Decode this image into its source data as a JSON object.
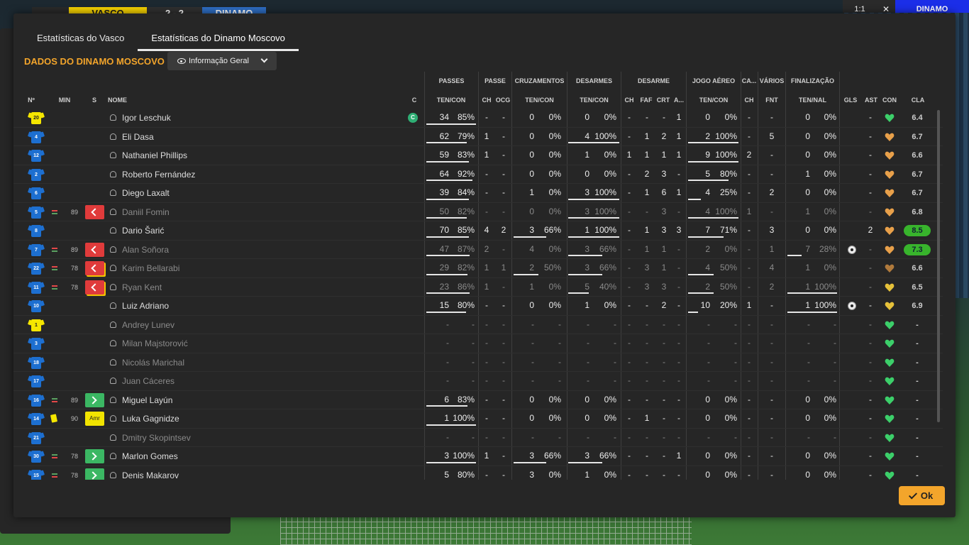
{
  "scoreboard": {
    "home": "VASCO",
    "score": "2 - 2",
    "away": "DINAMO",
    "right_btn1": "1:1",
    "right_btn2": "✕",
    "right_btn3": "DINAMO"
  },
  "tabs": [
    {
      "label": "Estatísticas do Vasco",
      "active": false
    },
    {
      "label": "Estatísticas do Dinamo Moscovo",
      "active": true
    }
  ],
  "section_title": "DADOS DO DINAMO MOSCOVO",
  "view_selector": {
    "label": "Informação Geral"
  },
  "group_headers": [
    "PASSES",
    "PASSE",
    "CRUZAMENTOS",
    "DESARMES",
    "DESARME",
    "JOGO AÉREO",
    "CA...",
    "VÁRIOS",
    "FINALIZAÇÃO"
  ],
  "column_headers": {
    "num": "Nº",
    "min": "MIN",
    "s": "S",
    "name": "NOME",
    "c": "C",
    "passes": "TEN/CON",
    "passe_ch": "CH",
    "passe_ocg": "OCG",
    "cruz": "TEN/CON",
    "des": "TEN/CON",
    "d_ch": "CH",
    "d_faf": "FAF",
    "d_crt": "CRT",
    "d_a": "A...",
    "aereo": "TEN/CON",
    "ca_ch": "CH",
    "fnt": "FNT",
    "fin": "TEN/NAL",
    "gls": "GLS",
    "ast": "AST",
    "con": "CON",
    "cla": "CLA"
  },
  "players": [
    {
      "num": "20",
      "kit": "yellow",
      "name": "Igor Leschuk",
      "captain": "C",
      "min": "",
      "sub": "",
      "pt": "34",
      "pp": "85%",
      "ch": "-",
      "ocg": "-",
      "ct": "0",
      "cp": "0%",
      "dt": "0",
      "dp": "0%",
      "dch": "-",
      "faf": "-",
      "crt": "-",
      "da": "1",
      "at": "0",
      "ap": "0%",
      "cach": "-",
      "fnt": "-",
      "ft": "0",
      "fp": "0%",
      "gls": "",
      "ast": "-",
      "con": "green",
      "cla": "6.4",
      "dim": false,
      "u": [
        1,
        0,
        0,
        0,
        0,
        0
      ],
      "clag": false
    },
    {
      "num": "4",
      "kit": "blue",
      "name": "Eli Dasa",
      "captain": "",
      "min": "",
      "sub": "",
      "pt": "62",
      "pp": "79%",
      "ch": "1",
      "ocg": "-",
      "ct": "0",
      "cp": "0%",
      "dt": "4",
      "dp": "100%",
      "dch": "-",
      "faf": "1",
      "crt": "2",
      "da": "1",
      "at": "2",
      "ap": "100%",
      "cach": "-",
      "fnt": "5",
      "ft": "0",
      "fp": "0%",
      "gls": "",
      "ast": "-",
      "con": "orange",
      "cla": "6.7",
      "dim": false,
      "u": [
        0.82,
        0,
        0,
        1,
        1,
        0
      ],
      "clag": false
    },
    {
      "num": "12",
      "kit": "blue",
      "name": "Nathaniel Phillips",
      "captain": "",
      "min": "",
      "sub": "",
      "pt": "59",
      "pp": "83%",
      "ch": "1",
      "ocg": "-",
      "ct": "0",
      "cp": "0%",
      "dt": "1",
      "dp": "0%",
      "dch": "1",
      "faf": "1",
      "crt": "1",
      "da": "1",
      "at": "9",
      "ap": "100%",
      "cach": "2",
      "fnt": "-",
      "ft": "0",
      "fp": "0%",
      "gls": "",
      "ast": "-",
      "con": "orange",
      "cla": "6.6",
      "dim": false,
      "u": [
        0.86,
        0,
        0,
        0,
        1,
        0
      ],
      "clag": false
    },
    {
      "num": "2",
      "kit": "blue",
      "name": "Roberto Fernández",
      "captain": "",
      "min": "",
      "sub": "",
      "pt": "64",
      "pp": "92%",
      "ch": "-",
      "ocg": "-",
      "ct": "0",
      "cp": "0%",
      "dt": "0",
      "dp": "0%",
      "dch": "-",
      "faf": "2",
      "crt": "3",
      "da": "-",
      "at": "5",
      "ap": "80%",
      "cach": "-",
      "fnt": "-",
      "ft": "1",
      "fp": "0%",
      "gls": "",
      "ast": "-",
      "con": "orange",
      "cla": "6.7",
      "dim": false,
      "u": [
        0.93,
        0,
        0,
        0,
        0.8,
        0
      ],
      "clag": false
    },
    {
      "num": "6",
      "kit": "blue",
      "name": "Diego Laxalt",
      "captain": "",
      "min": "",
      "sub": "",
      "pt": "39",
      "pp": "84%",
      "ch": "-",
      "ocg": "-",
      "ct": "1",
      "cp": "0%",
      "dt": "3",
      "dp": "100%",
      "dch": "-",
      "faf": "1",
      "crt": "6",
      "da": "1",
      "at": "4",
      "ap": "25%",
      "cach": "-",
      "fnt": "2",
      "ft": "0",
      "fp": "0%",
      "gls": "",
      "ast": "-",
      "con": "orange",
      "cla": "6.7",
      "dim": false,
      "u": [
        0.85,
        0,
        0,
        1,
        0.25,
        0
      ],
      "clag": false
    },
    {
      "num": "5",
      "kit": "blue",
      "name": "Daniil Fomin",
      "captain": "",
      "min": "89",
      "sub": "out",
      "pt": "50",
      "pp": "82%",
      "ch": "-",
      "ocg": "-",
      "ct": "0",
      "cp": "0%",
      "dt": "3",
      "dp": "100%",
      "dch": "-",
      "faf": "-",
      "crt": "3",
      "da": "-",
      "at": "4",
      "ap": "100%",
      "cach": "1",
      "fnt": "-",
      "ft": "1",
      "fp": "0%",
      "gls": "",
      "ast": "-",
      "con": "orange",
      "cla": "6.8",
      "dim": true,
      "u": [
        0.82,
        0,
        0,
        1,
        1,
        0
      ],
      "clag": false
    },
    {
      "num": "8",
      "kit": "blue",
      "name": "Dario Šarić",
      "captain": "",
      "min": "",
      "sub": "",
      "pt": "70",
      "pp": "85%",
      "ch": "4",
      "ocg": "2",
      "ct": "3",
      "cp": "66%",
      "dt": "1",
      "dp": "100%",
      "dch": "-",
      "faf": "1",
      "crt": "3",
      "da": "3",
      "at": "7",
      "ap": "71%",
      "cach": "-",
      "fnt": "3",
      "ft": "0",
      "fp": "0%",
      "gls": "",
      "ast": "2",
      "con": "orange",
      "cla": "8.5",
      "dim": false,
      "u": [
        0.86,
        0,
        0.66,
        1,
        0.71,
        0
      ],
      "clag": true
    },
    {
      "num": "7",
      "kit": "blue",
      "name": "Alan Soñora",
      "captain": "",
      "min": "89",
      "sub": "out",
      "pt": "47",
      "pp": "87%",
      "ch": "2",
      "ocg": "-",
      "ct": "4",
      "cp": "0%",
      "dt": "3",
      "dp": "66%",
      "dch": "-",
      "faf": "1",
      "crt": "1",
      "da": "-",
      "at": "2",
      "ap": "0%",
      "cach": "-",
      "fnt": "1",
      "ft": "7",
      "fp": "28%",
      "gls": "ball",
      "ast": "-",
      "con": "orange",
      "cla": "7.3",
      "dim": true,
      "u": [
        0.87,
        0,
        0,
        0.66,
        0,
        0.28
      ],
      "clag": true
    },
    {
      "num": "22",
      "kit": "blue",
      "name": "Karim Bellarabi",
      "captain": "",
      "min": "78",
      "sub": "outy",
      "pt": "29",
      "pp": "82%",
      "ch": "1",
      "ocg": "1",
      "ct": "2",
      "cp": "50%",
      "dt": "3",
      "dp": "66%",
      "dch": "-",
      "faf": "3",
      "crt": "1",
      "da": "-",
      "at": "4",
      "ap": "50%",
      "cach": "-",
      "fnt": "4",
      "ft": "1",
      "fp": "0%",
      "gls": "",
      "ast": "-",
      "con": "brown",
      "cla": "6.6",
      "dim": true,
      "u": [
        0.83,
        0,
        0.5,
        0.66,
        0.5,
        0
      ],
      "clag": false
    },
    {
      "num": "11",
      "kit": "blue",
      "name": "Ryan Kent",
      "captain": "",
      "min": "78",
      "sub": "outy",
      "pt": "23",
      "pp": "86%",
      "ch": "1",
      "ocg": "-",
      "ct": "1",
      "cp": "0%",
      "dt": "5",
      "dp": "40%",
      "dch": "-",
      "faf": "3",
      "crt": "3",
      "da": "-",
      "at": "2",
      "ap": "50%",
      "cach": "-",
      "fnt": "2",
      "ft": "1",
      "fp": "100%",
      "gls": "",
      "ast": "-",
      "con": "yellow",
      "cla": "6.5",
      "dim": true,
      "u": [
        0.87,
        0,
        0,
        0.4,
        0.5,
        1
      ],
      "clag": false
    },
    {
      "num": "10",
      "kit": "blue",
      "name": "Luiz Adriano",
      "captain": "",
      "min": "",
      "sub": "",
      "pt": "15",
      "pp": "80%",
      "ch": "-",
      "ocg": "-",
      "ct": "0",
      "cp": "0%",
      "dt": "1",
      "dp": "0%",
      "dch": "-",
      "faf": "-",
      "crt": "2",
      "da": "-",
      "at": "10",
      "ap": "20%",
      "cach": "1",
      "fnt": "-",
      "ft": "1",
      "fp": "100%",
      "gls": "ball",
      "ast": "-",
      "con": "yellow",
      "cla": "6.9",
      "dim": false,
      "u": [
        0.8,
        0,
        0,
        0,
        0.2,
        1
      ],
      "clag": false
    },
    {
      "num": "1",
      "kit": "yellow",
      "name": "Andrey Lunev",
      "captain": "",
      "min": "",
      "sub": "",
      "pt": "-",
      "pp": "-",
      "ch": "-",
      "ocg": "-",
      "ct": "-",
      "cp": "-",
      "dt": "-",
      "dp": "-",
      "dch": "-",
      "faf": "-",
      "crt": "-",
      "da": "-",
      "at": "-",
      "ap": "-",
      "cach": "-",
      "fnt": "-",
      "ft": "-",
      "fp": "-",
      "gls": "",
      "ast": "-",
      "con": "green",
      "cla": "-",
      "dim": true,
      "u": [
        0,
        0,
        0,
        0,
        0,
        0
      ],
      "clag": false
    },
    {
      "num": "3",
      "kit": "blue",
      "name": "Milan Majstorović",
      "captain": "",
      "min": "",
      "sub": "",
      "pt": "-",
      "pp": "-",
      "ch": "-",
      "ocg": "-",
      "ct": "-",
      "cp": "-",
      "dt": "-",
      "dp": "-",
      "dch": "-",
      "faf": "-",
      "crt": "-",
      "da": "-",
      "at": "-",
      "ap": "-",
      "cach": "-",
      "fnt": "-",
      "ft": "-",
      "fp": "-",
      "gls": "",
      "ast": "-",
      "con": "green",
      "cla": "-",
      "dim": true,
      "u": [
        0,
        0,
        0,
        0,
        0,
        0
      ],
      "clag": false
    },
    {
      "num": "18",
      "kit": "blue",
      "name": "Nicolás Marichal",
      "captain": "",
      "min": "",
      "sub": "",
      "pt": "-",
      "pp": "-",
      "ch": "-",
      "ocg": "-",
      "ct": "-",
      "cp": "-",
      "dt": "-",
      "dp": "-",
      "dch": "-",
      "faf": "-",
      "crt": "-",
      "da": "-",
      "at": "-",
      "ap": "-",
      "cach": "-",
      "fnt": "-",
      "ft": "-",
      "fp": "-",
      "gls": "",
      "ast": "-",
      "con": "green",
      "cla": "-",
      "dim": true,
      "u": [
        0,
        0,
        0,
        0,
        0,
        0
      ],
      "clag": false
    },
    {
      "num": "17",
      "kit": "blue",
      "name": "Juan Cáceres",
      "captain": "",
      "min": "",
      "sub": "",
      "pt": "-",
      "pp": "-",
      "ch": "-",
      "ocg": "-",
      "ct": "-",
      "cp": "-",
      "dt": "-",
      "dp": "-",
      "dch": "-",
      "faf": "-",
      "crt": "-",
      "da": "-",
      "at": "-",
      "ap": "-",
      "cach": "-",
      "fnt": "-",
      "ft": "-",
      "fp": "-",
      "gls": "",
      "ast": "-",
      "con": "green",
      "cla": "-",
      "dim": true,
      "u": [
        0,
        0,
        0,
        0,
        0,
        0
      ],
      "clag": false
    },
    {
      "num": "16",
      "kit": "blue",
      "name": "Miguel Layún",
      "captain": "",
      "min": "89",
      "sub": "in",
      "pt": "6",
      "pp": "83%",
      "ch": "-",
      "ocg": "-",
      "ct": "0",
      "cp": "0%",
      "dt": "0",
      "dp": "0%",
      "dch": "-",
      "faf": "-",
      "crt": "-",
      "da": "-",
      "at": "0",
      "ap": "0%",
      "cach": "-",
      "fnt": "-",
      "ft": "0",
      "fp": "0%",
      "gls": "",
      "ast": "-",
      "con": "green",
      "cla": "-",
      "dim": false,
      "u": [
        0.83,
        0,
        0,
        0,
        0,
        0
      ],
      "clag": false
    },
    {
      "num": "14",
      "kit": "blue",
      "name": "Luka Gagnidze",
      "captain": "",
      "min": "90",
      "sub": "amr",
      "pt": "1",
      "pp": "100%",
      "ch": "-",
      "ocg": "-",
      "ct": "0",
      "cp": "0%",
      "dt": "0",
      "dp": "0%",
      "dch": "-",
      "faf": "1",
      "crt": "-",
      "da": "-",
      "at": "0",
      "ap": "0%",
      "cach": "-",
      "fnt": "-",
      "ft": "0",
      "fp": "0%",
      "gls": "",
      "ast": "-",
      "con": "green",
      "cla": "-",
      "dim": false,
      "u": [
        1,
        0,
        0,
        0,
        0,
        0
      ],
      "clag": false
    },
    {
      "num": "21",
      "kit": "blue",
      "name": "Dmitry Skopintsev",
      "captain": "",
      "min": "",
      "sub": "",
      "pt": "-",
      "pp": "-",
      "ch": "-",
      "ocg": "-",
      "ct": "-",
      "cp": "-",
      "dt": "-",
      "dp": "-",
      "dch": "-",
      "faf": "-",
      "crt": "-",
      "da": "-",
      "at": "-",
      "ap": "-",
      "cach": "-",
      "fnt": "-",
      "ft": "-",
      "fp": "-",
      "gls": "",
      "ast": "-",
      "con": "green",
      "cla": "-",
      "dim": true,
      "u": [
        0,
        0,
        0,
        0,
        0,
        0
      ],
      "clag": false
    },
    {
      "num": "30",
      "kit": "blue",
      "name": "Marlon Gomes",
      "captain": "",
      "min": "78",
      "sub": "in",
      "pt": "3",
      "pp": "100%",
      "ch": "1",
      "ocg": "-",
      "ct": "3",
      "cp": "66%",
      "dt": "3",
      "dp": "66%",
      "dch": "-",
      "faf": "-",
      "crt": "-",
      "da": "1",
      "at": "0",
      "ap": "0%",
      "cach": "-",
      "fnt": "-",
      "ft": "0",
      "fp": "0%",
      "gls": "",
      "ast": "-",
      "con": "green",
      "cla": "-",
      "dim": false,
      "u": [
        1,
        0,
        0.66,
        0.66,
        0,
        0
      ],
      "clag": false
    },
    {
      "num": "15",
      "kit": "blue",
      "name": "Denis Makarov",
      "captain": "",
      "min": "78",
      "sub": "in",
      "pt": "5",
      "pp": "80%",
      "ch": "-",
      "ocg": "-",
      "ct": "3",
      "cp": "0%",
      "dt": "1",
      "dp": "0%",
      "dch": "-",
      "faf": "-",
      "crt": "-",
      "da": "-",
      "at": "0",
      "ap": "0%",
      "cach": "-",
      "fnt": "-",
      "ft": "0",
      "fp": "0%",
      "gls": "",
      "ast": "-",
      "con": "green",
      "cla": "-",
      "dim": false,
      "u": [
        0.8,
        0,
        0,
        0,
        0,
        0
      ],
      "clag": false
    }
  ],
  "sub_badge_text": {
    "amr": "Amr"
  },
  "ok_button": "Ok",
  "colors": {
    "accent": "#f3a52b",
    "green": "#38b42c",
    "red": "#e03b3b"
  }
}
